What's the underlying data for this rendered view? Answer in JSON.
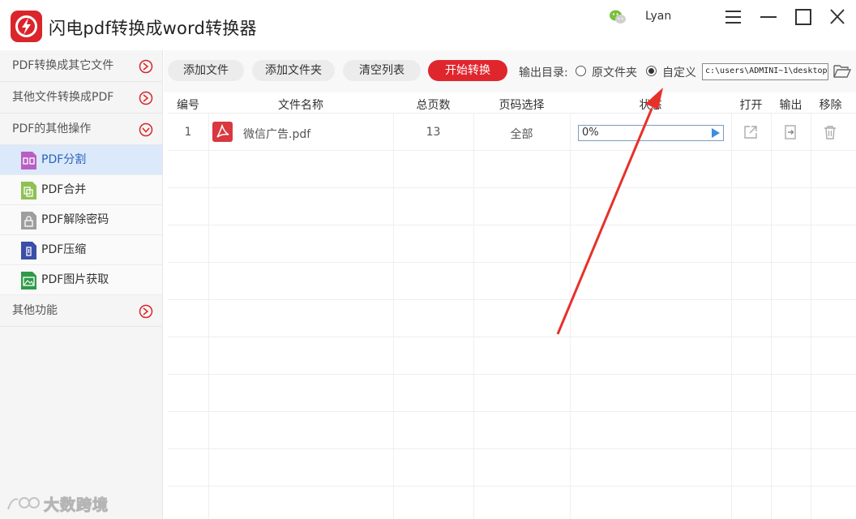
{
  "app": {
    "title": "闪电pdf转换成word转换器",
    "username": "Lyan",
    "brand_color": "#d9252b"
  },
  "sidebar": {
    "groups": [
      {
        "label": "PDF转换成其它文件",
        "state": "collapsed"
      },
      {
        "label": "其他文件转换成PDF",
        "state": "collapsed"
      },
      {
        "label": "PDF的其他操作",
        "state": "expanded"
      }
    ],
    "items": [
      {
        "label": "PDF分割",
        "icon": "pdf-split-icon",
        "color": "#b85fc4",
        "active": true
      },
      {
        "label": "PDF合并",
        "icon": "pdf-merge-icon",
        "color": "#8dc152",
        "active": false
      },
      {
        "label": "PDF解除密码",
        "icon": "pdf-unlock-icon",
        "color": "#9e9e9e",
        "active": false
      },
      {
        "label": "PDF压缩",
        "icon": "pdf-compress-icon",
        "color": "#3b4fa8",
        "active": false
      },
      {
        "label": "PDF图片获取",
        "icon": "pdf-image-icon",
        "color": "#2e9a48",
        "active": false
      }
    ],
    "other": {
      "label": "其他功能",
      "state": "collapsed"
    }
  },
  "toolbar": {
    "add_file": "添加文件",
    "add_folder": "添加文件夹",
    "clear_list": "清空列表",
    "start_convert": "开始转换",
    "output_dir_label": "输出目录:",
    "option_original": "原文件夹",
    "option_custom": "自定义",
    "selected_option": "自定义",
    "output_path": "c:\\users\\ADMINI~1\\desktop"
  },
  "table": {
    "columns": [
      "编号",
      "文件名称",
      "总页数",
      "页码选择",
      "状态",
      "打开",
      "输出",
      "移除"
    ],
    "rows": [
      {
        "index": "1",
        "file_name": "微信广告.pdf",
        "pages": "13",
        "page_selection": "全部",
        "status": "0%",
        "progress": 0
      }
    ],
    "empty_rows": 9
  },
  "watermark": {
    "text": "大数跨境"
  }
}
